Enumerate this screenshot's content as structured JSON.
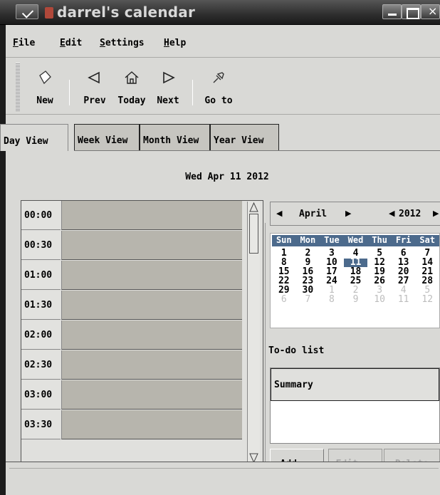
{
  "window": {
    "title": "darrel's calendar"
  },
  "menubar": {
    "items": [
      {
        "label": "File",
        "accel": "F",
        "rest": "ile"
      },
      {
        "label": "Edit",
        "accel": "E",
        "rest": "dit"
      },
      {
        "label": "Settings",
        "accel": "S",
        "rest": "ettings"
      },
      {
        "label": "Help",
        "accel": "H",
        "rest": "elp"
      }
    ]
  },
  "toolbar": {
    "new_label": "New",
    "prev_label": "Prev",
    "today_label": "Today",
    "next_label": "Next",
    "goto_label": "Go to"
  },
  "tabs": [
    "Day View",
    "Week View",
    "Month View",
    "Year View"
  ],
  "active_tab": "Day View",
  "day_view": {
    "date": "Wed Apr 11 2012",
    "times": [
      "00:00",
      "00:30",
      "01:00",
      "01:30",
      "02:00",
      "02:30",
      "03:00",
      "03:30"
    ]
  },
  "mini_calendar": {
    "month": "April",
    "year": "2012",
    "weekdays": [
      "Sun",
      "Mon",
      "Tue",
      "Wed",
      "Thu",
      "Fri",
      "Sat"
    ],
    "weeks": [
      [
        "1",
        "2",
        "3",
        "4",
        "5",
        "6",
        "7"
      ],
      [
        "8",
        "9",
        "10",
        "11",
        "12",
        "13",
        "14"
      ],
      [
        "15",
        "16",
        "17",
        "18",
        "19",
        "20",
        "21"
      ],
      [
        "22",
        "23",
        "24",
        "25",
        "26",
        "27",
        "28"
      ],
      [
        "29",
        "30",
        "1",
        "2",
        "3",
        "4",
        "5"
      ],
      [
        "6",
        "7",
        "8",
        "9",
        "10",
        "11",
        "12"
      ]
    ],
    "selected": "11",
    "selection_color": "#4c6a8c"
  },
  "todo": {
    "label": "To-do list",
    "column_summary": "Summary",
    "add_label": "Add...",
    "edit_label": "Edit...",
    "delete_label": "Delete"
  },
  "icons": {
    "new": "new-page-icon",
    "prev": "left-arrow-icon",
    "today": "home-icon",
    "next": "right-arrow-icon",
    "goto": "jump-icon"
  }
}
